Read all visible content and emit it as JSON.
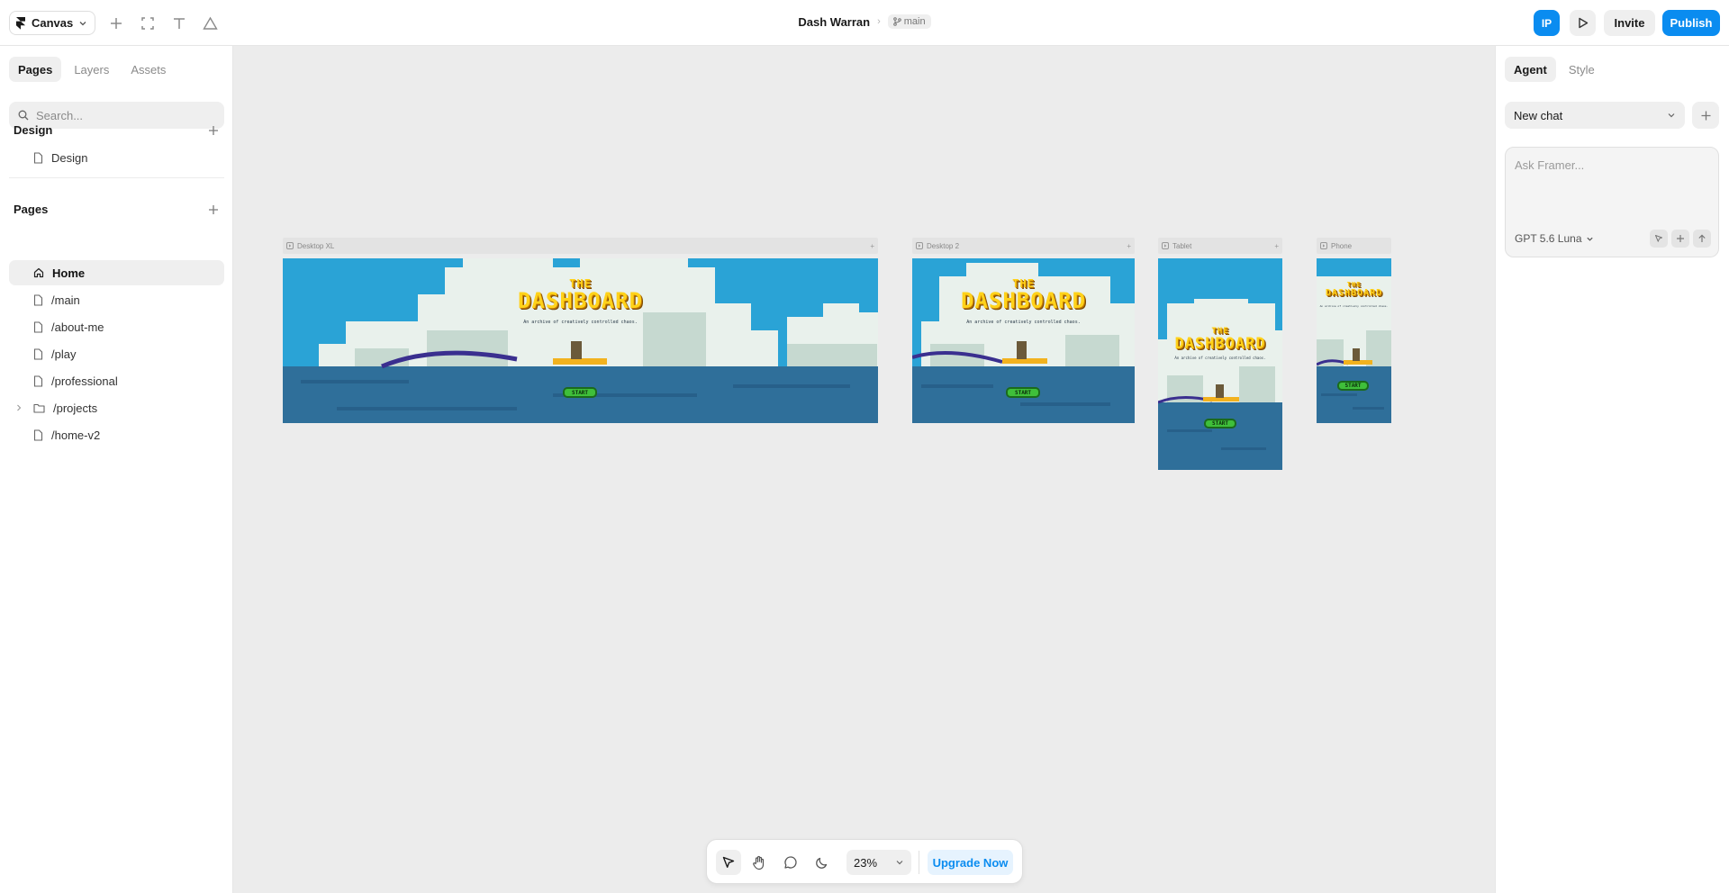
{
  "app": {
    "menu_label": "Canvas"
  },
  "document": {
    "title": "Dash Warran",
    "branch": "main"
  },
  "header": {
    "avatar_initials": "IP",
    "invite_label": "Invite",
    "publish_label": "Publish"
  },
  "left_panel": {
    "tabs": [
      {
        "label": "Pages",
        "active": true
      },
      {
        "label": "Layers",
        "active": false
      },
      {
        "label": "Assets",
        "active": false
      }
    ],
    "search_placeholder": "Search...",
    "design_section": {
      "title": "Design",
      "items": [
        {
          "label": "Design"
        }
      ]
    },
    "pages_section": {
      "title": "Pages",
      "items": [
        {
          "label": "Home",
          "icon": "home-icon",
          "active": true
        },
        {
          "label": "/main",
          "icon": "page-icon"
        },
        {
          "label": "/about-me",
          "icon": "page-icon"
        },
        {
          "label": "/play",
          "icon": "page-icon"
        },
        {
          "label": "/professional",
          "icon": "page-icon"
        },
        {
          "label": "/projects",
          "icon": "folder-icon",
          "collapsible": true
        },
        {
          "label": "/home-v2",
          "icon": "page-icon"
        }
      ]
    }
  },
  "right_panel": {
    "tabs": [
      {
        "label": "Agent",
        "active": true
      },
      {
        "label": "Style",
        "active": false
      }
    ],
    "chat_select": "New chat",
    "ask_placeholder": "Ask Framer...",
    "model": "GPT 5.6 Luna"
  },
  "canvas": {
    "frames": [
      {
        "label": "Desktop XL"
      },
      {
        "label": "Desktop 2"
      },
      {
        "label": "Tablet"
      },
      {
        "label": "Phone"
      }
    ],
    "hero": {
      "title_line1": "THE",
      "title_line2": "DASHBOARD",
      "subtitle": "An archive of creatively controlled chaos.",
      "button_label": "START"
    }
  },
  "bottom_toolbar": {
    "zoom": "23%",
    "upgrade_label": "Upgrade Now"
  },
  "colors": {
    "accent": "#0a8cf0",
    "canvas_bg": "#ececec",
    "sky": "#2b9fd3",
    "sea": "#2f6f9a",
    "title_yellow": "#ffd21a",
    "start_green": "#3fbf3a"
  }
}
